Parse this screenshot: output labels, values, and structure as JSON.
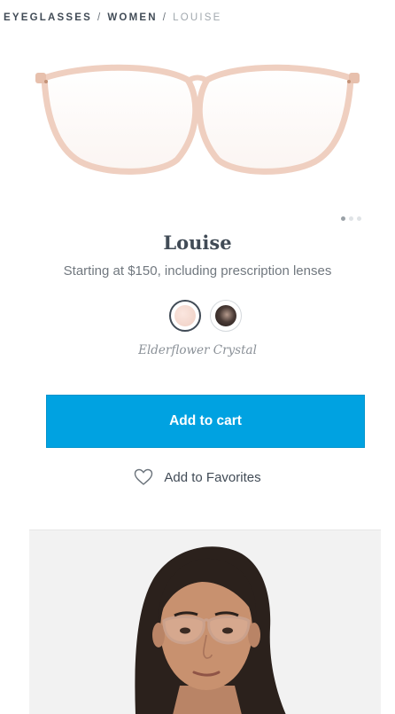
{
  "breadcrumb": {
    "items": [
      "EYEGLASSES",
      "WOMEN"
    ],
    "separator": "/",
    "current": "LOUISE"
  },
  "product": {
    "name": "Louise",
    "price_line": "Starting at $150, including prescription lenses",
    "selected_color": "Elderflower Crystal",
    "swatches": [
      {
        "name": "elderflower-crystal-swatch",
        "color": "#f3d7cd",
        "selected": true
      },
      {
        "name": "dark-tortoise-swatch",
        "color": "#4a3b36",
        "selected": false
      }
    ]
  },
  "actions": {
    "add_to_cart": "Add to cart",
    "add_to_favorites": "Add to Favorites"
  },
  "carousel": {
    "count": 3,
    "active": 0
  },
  "colors": {
    "accent": "#00a2e1",
    "text": "#414b56",
    "frame": "#f0d4c8"
  },
  "icons": {
    "favorite": "heart-outline-icon"
  }
}
